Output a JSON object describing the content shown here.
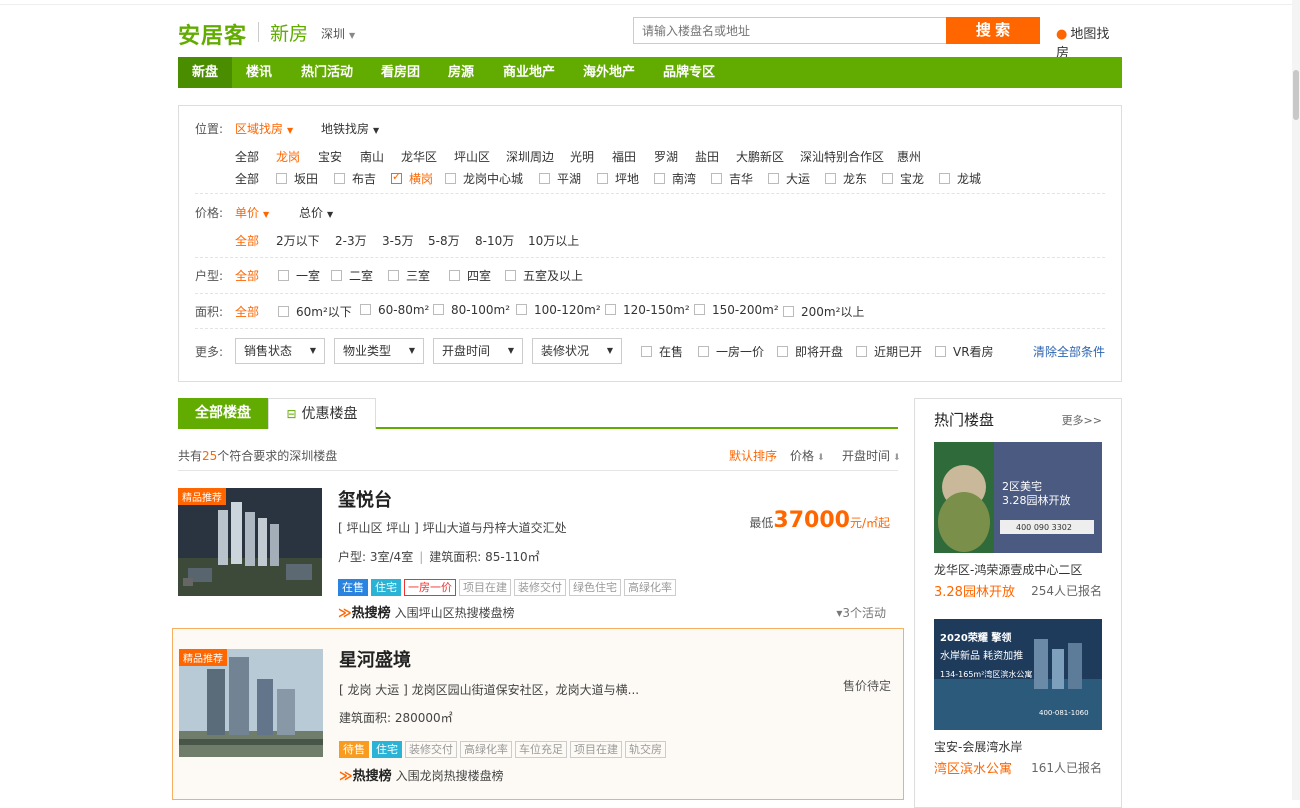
{
  "header": {
    "logo": "安居客",
    "channel": "新房",
    "city": "深圳",
    "search_placeholder": "请输入楼盘名或地址",
    "search_button": "搜 索",
    "map_link": "地图找房"
  },
  "nav": [
    "新盘",
    "楼讯",
    "热门活动",
    "看房团",
    "房源",
    "商业地产",
    "海外地产",
    "品牌专区"
  ],
  "filter": {
    "location": {
      "label": "位置:",
      "modes": [
        "区域找房",
        "地铁找房"
      ],
      "districts": [
        "全部",
        "龙岗",
        "宝安",
        "南山",
        "龙华区",
        "坪山区",
        "深圳周边",
        "光明",
        "福田",
        "罗湖",
        "盐田",
        "大鹏新区",
        "深汕特别合作区",
        "惠州"
      ],
      "sub_all": "全部",
      "subareas": [
        "坂田",
        "布吉",
        "横岗",
        "龙岗中心城",
        "平湖",
        "坪地",
        "南湾",
        "吉华",
        "大运",
        "龙东",
        "宝龙",
        "龙城"
      ]
    },
    "price": {
      "label": "价格:",
      "modes": [
        "单价",
        "总价"
      ],
      "options": [
        "全部",
        "2万以下",
        "2-3万",
        "3-5万",
        "5-8万",
        "8-10万",
        "10万以上"
      ]
    },
    "layout": {
      "label": "户型:",
      "all": "全部",
      "options": [
        "一室",
        "二室",
        "三室",
        "四室",
        "五室及以上"
      ]
    },
    "area": {
      "label": "面积:",
      "all": "全部",
      "options": [
        "60m²以下",
        "60-80m²",
        "80-100m²",
        "100-120m²",
        "120-150m²",
        "150-200m²",
        "200m²以上"
      ]
    },
    "more": {
      "label": "更多:",
      "selects": [
        "销售状态",
        "物业类型",
        "开盘时间",
        "装修状况"
      ],
      "checks": [
        "在售",
        "一房一价",
        "即将开盘",
        "近期已开",
        "VR看房"
      ],
      "clear": "清除全部条件"
    }
  },
  "tabs": {
    "all": "全部楼盘",
    "discount": "优惠楼盘"
  },
  "summary": {
    "prefix": "共有",
    "count": "25",
    "suffix": "个符合要求的深圳楼盘"
  },
  "sorts": [
    "默认排序",
    "价格",
    "开盘时间"
  ],
  "listings": [
    {
      "badge": "精品推荐",
      "name": "玺悦台",
      "address": "[ 坪山区 坪山 ] 坪山大道与丹梓大道交汇处",
      "layout_label": "户型:",
      "layout": "3室/4室",
      "area_label": "建筑面积:",
      "area": "85-110㎡",
      "tags": [
        "在售",
        "住宅",
        "一房一价",
        "项目在建",
        "装修交付",
        "绿色住宅",
        "高绿化率"
      ],
      "rank_brand": "热搜榜",
      "rank_text": "入围坪山区热搜楼盘榜",
      "price_prefix": "最低",
      "price": "37000",
      "price_unit": "元/㎡起",
      "activity": "3个活动"
    },
    {
      "badge": "精品推荐",
      "name": "星河盛境",
      "address": "[ 龙岗 大运 ] 龙岗区园山街道保安社区，龙岗大道与横...",
      "area_label": "建筑面积:",
      "area": "280000㎡",
      "tags": [
        "待售",
        "住宅",
        "装修交付",
        "高绿化率",
        "车位充足",
        "项目在建",
        "轨交房"
      ],
      "rank_brand": "热搜榜",
      "rank_text": "入围龙岗热搜楼盘榜",
      "status": "售价待定"
    }
  ],
  "sidebar": {
    "title": "热门楼盘",
    "more": "更多>>",
    "cards": [
      {
        "name": "龙华区-鸿荣源壹成中心二区",
        "promo": "3.28园林开放",
        "registered": "254人已报名",
        "img_text1": "2区美宅",
        "img_text2": "3.28园林开放",
        "img_phone": "400 090 3302"
      },
      {
        "name": "宝安-会展湾水岸",
        "promo": "湾区滨水公寓",
        "registered": "161人已报名",
        "img_text1": "2020荣耀 擎领",
        "img_text2": "水岸新品 耗资加推",
        "img_text3": "134-165m²湾区滨水公寓",
        "img_phone": "400-081-1060"
      }
    ]
  }
}
